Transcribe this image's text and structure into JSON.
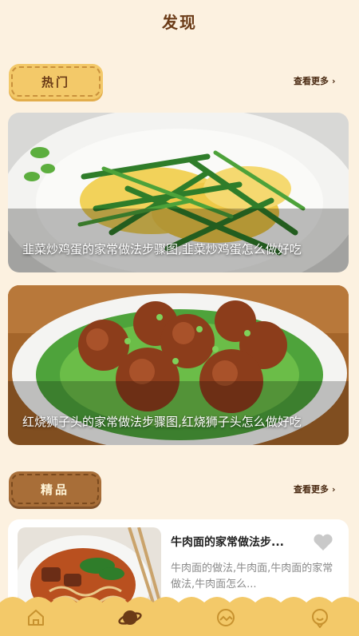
{
  "header": {
    "title": "发现"
  },
  "hot": {
    "label": "热门",
    "more": "查看更多",
    "cards": [
      {
        "caption": "韭菜炒鸡蛋的家常做法步骤图,韭菜炒鸡蛋怎么做好吃"
      },
      {
        "caption": "红烧狮子头的家常做法步骤图,红烧狮子头怎么做好吃"
      }
    ]
  },
  "featured": {
    "label": "精品",
    "more": "查看更多",
    "items": [
      {
        "title": "牛肉面的家常做法步...",
        "desc": "牛肉面的做法,牛肉面,牛肉面的家常做法,牛肉面怎么..."
      }
    ]
  },
  "tabbar": {
    "icons": [
      "home-icon",
      "planet-icon",
      "picture-icon",
      "profile-icon"
    ]
  },
  "colors": {
    "background": "#fcf1e0",
    "accent": "#f3c969",
    "brown": "#a86e38"
  }
}
